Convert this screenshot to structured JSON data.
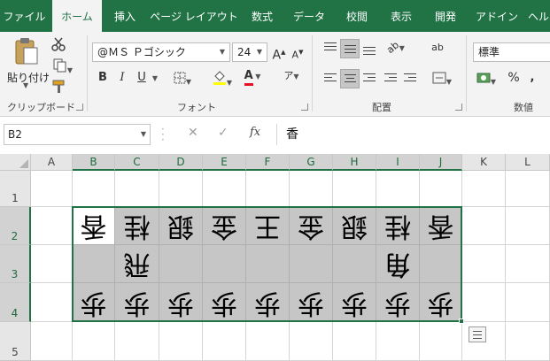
{
  "tabs": [
    "ファイル",
    "ホーム",
    "挿入",
    "ページ レイアウト",
    "数式",
    "データ",
    "校閲",
    "表示",
    "開発",
    "アドイン",
    "ヘル"
  ],
  "active_tab": "ホーム",
  "ribbon": {
    "clipboard": {
      "label": "クリップボード",
      "paste_label": "貼り付け"
    },
    "font": {
      "label": "フォント",
      "font_name": "@ＭＳ Ｐゴシック",
      "font_size": "24",
      "grow_glyph": "A",
      "shrink_glyph": "A",
      "bold_glyph": "B",
      "italic_glyph": "I",
      "underline_glyph": "U",
      "font_color_glyph": "A",
      "phonetic_glyph": "ア",
      "font_color": "#e81123"
    },
    "alignment": {
      "label": "配置",
      "wrap_glyph": "ab"
    },
    "number": {
      "label": "数値",
      "format": "標準",
      "percent_glyph": "%"
    }
  },
  "formula_bar": {
    "name_box": "B2",
    "cancel_glyph": "✕",
    "enter_glyph": "✓",
    "fx_glyph": "fx",
    "formula": "香"
  },
  "columns": [
    "A",
    "B",
    "C",
    "D",
    "E",
    "F",
    "G",
    "H",
    "I",
    "J",
    "K",
    "L"
  ],
  "rows": [
    "1",
    "2",
    "3",
    "4",
    "5"
  ],
  "selected_range": "B2:J4",
  "cells": {
    "row2": [
      "香",
      "桂",
      "銀",
      "金",
      "王",
      "金",
      "銀",
      "桂",
      "香"
    ],
    "row3": [
      "",
      "飛",
      "",
      "",
      "",
      "",
      "",
      "角",
      ""
    ],
    "row4": [
      "歩",
      "歩",
      "歩",
      "歩",
      "歩",
      "歩",
      "歩",
      "歩",
      "歩"
    ]
  },
  "colors": {
    "accent": "#217346",
    "selection_fill": "#c6c6c6"
  }
}
